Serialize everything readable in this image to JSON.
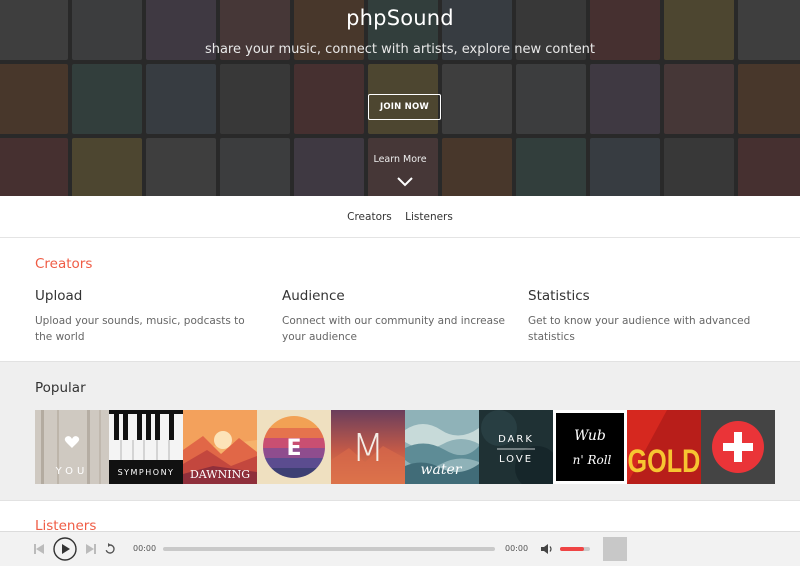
{
  "hero": {
    "title": "phpSound",
    "subtitle": "share your music, connect with artists, explore new content",
    "join_label": "JOIN NOW",
    "learn_more": "Learn More"
  },
  "subnav": {
    "creators": "Creators",
    "listeners": "Listeners"
  },
  "creators": {
    "heading": "Creators",
    "features": [
      {
        "title": "Upload",
        "desc": "Upload your sounds, music, podcasts to the world"
      },
      {
        "title": "Audience",
        "desc": "Connect with our community and increase your audience"
      },
      {
        "title": "Statistics",
        "desc": "Get to know your audience with advanced statistics"
      }
    ]
  },
  "popular": {
    "heading": "Popular",
    "tracks": [
      {
        "art_text": "YOU"
      },
      {
        "art_text": "SYMPHONY"
      },
      {
        "art_text": "DAWNING"
      },
      {
        "art_text": "E"
      },
      {
        "art_text": "M"
      },
      {
        "art_text": "water"
      },
      {
        "art_text": "DARK",
        "art_text2": "LOVE"
      },
      {
        "art_text": "Wub",
        "art_text2": "n' Roll"
      },
      {
        "art_text": "GOLD"
      },
      {
        "art_text": ""
      }
    ]
  },
  "listeners": {
    "heading": "Listeners"
  },
  "player": {
    "current_time": "00:00",
    "duration": "00:00",
    "volume": 0.8,
    "progress": 0
  },
  "colors": {
    "accent": "#ef5c45",
    "volume": "#ef4444"
  }
}
